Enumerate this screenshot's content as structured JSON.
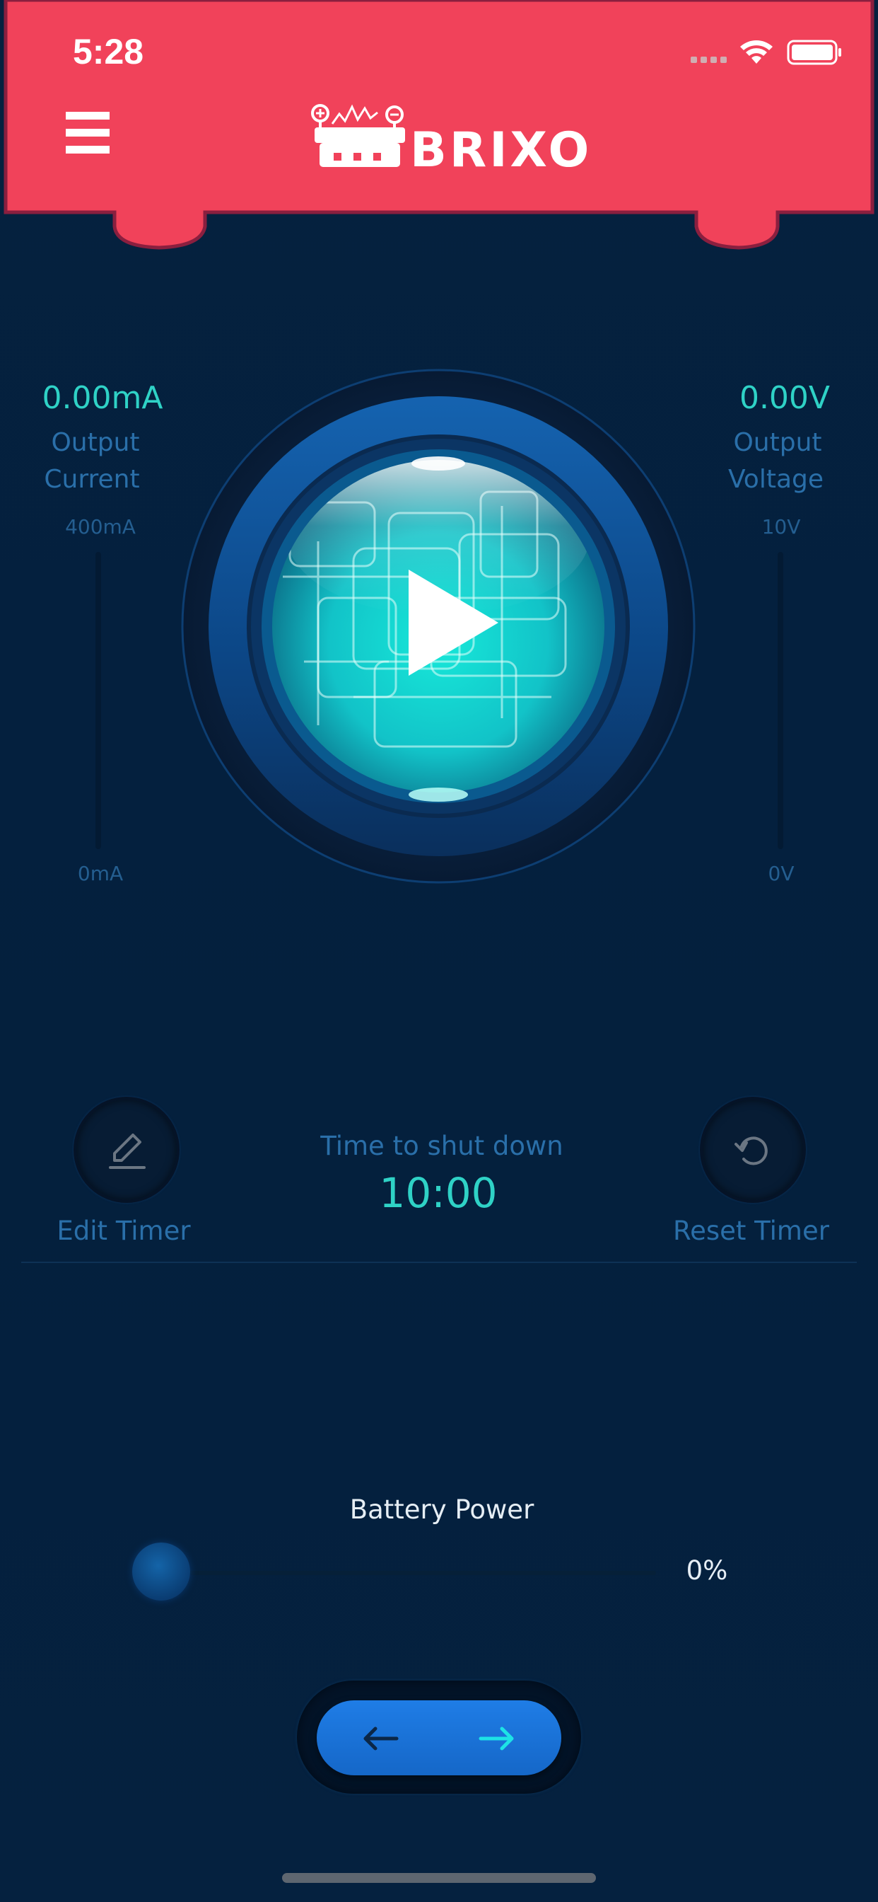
{
  "status_bar": {
    "time": "5:28"
  },
  "header": {
    "brand": "BRIXO",
    "menu_icon": "hamburger-menu-icon",
    "logo_icon": "brixo-robot-logo-icon"
  },
  "colors": {
    "header": "#f1425a",
    "background": "#05213f",
    "accent": "#2fd2c6",
    "label": "#2a6fa9"
  },
  "current_meter": {
    "value": "0.00mA",
    "label_line1": "Output",
    "label_line2": "Current",
    "max": "400mA",
    "min": "0mA",
    "level": 0
  },
  "voltage_meter": {
    "value": "0.00V",
    "label_line1": "Output",
    "label_line2": "Voltage",
    "max": "10V",
    "min": "0V",
    "level": 0
  },
  "play_button": {
    "icon": "play-icon"
  },
  "timer": {
    "edit_label": "Edit Timer",
    "edit_icon": "pencil-icon",
    "caption": "Time to shut down",
    "value": "10:00",
    "reset_label": "Reset Timer",
    "reset_icon": "reset-icon"
  },
  "battery": {
    "label": "Battery Power",
    "percent": "0%",
    "level": 0
  },
  "nav": {
    "back_icon": "arrow-left-icon",
    "forward_icon": "arrow-right-icon"
  }
}
